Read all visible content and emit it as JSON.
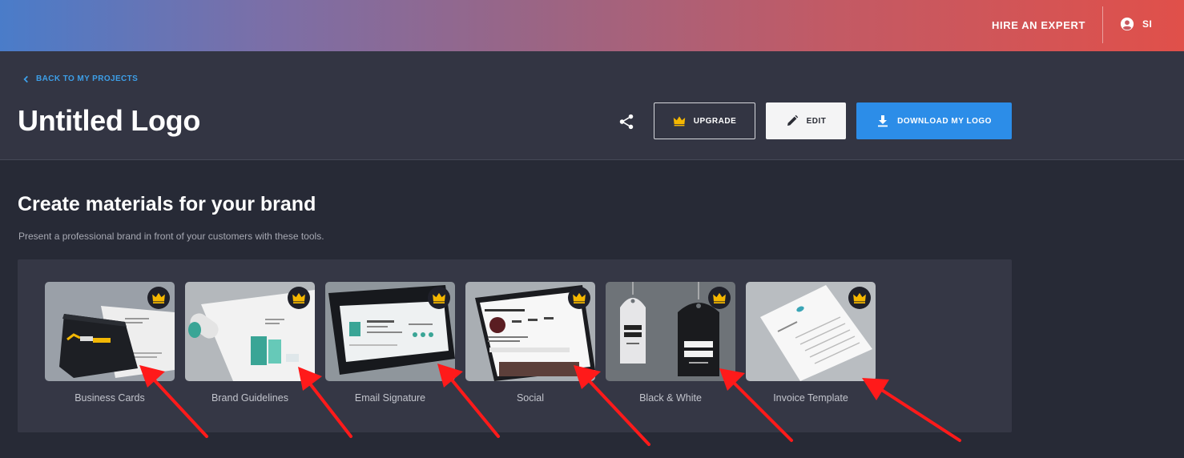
{
  "topbar": {
    "hire_label": "HIRE AN EXPERT",
    "user_initials": "SI"
  },
  "header": {
    "back_label": "BACK TO MY PROJECTS",
    "title": "Untitled Logo",
    "upgrade_label": "UPGRADE",
    "edit_label": "EDIT",
    "download_label": "DOWNLOAD MY LOGO"
  },
  "section": {
    "title": "Create materials for your brand",
    "subtitle": "Present a professional brand in front of your customers with these tools."
  },
  "tiles": [
    {
      "label": "Business Cards"
    },
    {
      "label": "Brand Guidelines"
    },
    {
      "label": "Email Signature"
    },
    {
      "label": "Social"
    },
    {
      "label": "Black & White"
    },
    {
      "label": "Invoice Template"
    }
  ],
  "colors": {
    "accent_blue": "#2c8de8",
    "link_blue": "#3d9fe8",
    "crown_gold": "#f5b700",
    "annotation_red": "#ff1a1a"
  },
  "icons": {
    "back": "chevron-left-icon",
    "user": "user-circle-icon",
    "share": "share-icon",
    "upgrade": "crown-icon",
    "edit": "pencil-icon",
    "download": "download-icon",
    "premium": "crown-icon"
  }
}
